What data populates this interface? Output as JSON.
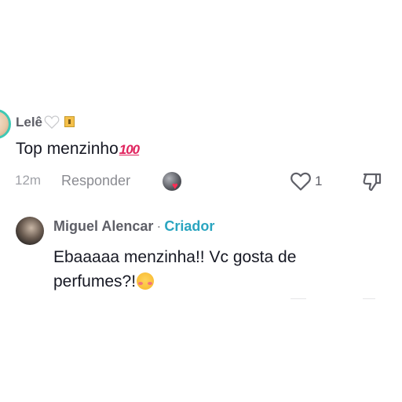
{
  "comment": {
    "username": "Lelê",
    "text": "Top menzinho",
    "emoji_suffix": "100",
    "time": "12m",
    "reply_label": "Responder",
    "like_count": "1",
    "icons": [
      "white-heart-icon",
      "house-icon",
      "hundred-points-icon",
      "liker-avatar",
      "red-heart-icon",
      "heart-outline-icon",
      "thumbs-down-icon"
    ]
  },
  "reply": {
    "username": "Miguel Alencar",
    "separator": "·",
    "badge": "Criador",
    "text": "Ebaaaaa menzinha!! Vc gosta de perfumes?!",
    "emoji": "smiling-face-with-hearts"
  },
  "colors": {
    "creator_badge": "#2aa5c0",
    "avatar_ring": "#3ec9b4",
    "like_heart": "#fe2c55",
    "username_gray": "#5e5f67",
    "meta_gray": "#a0a2a8",
    "text_dark": "#161823"
  }
}
